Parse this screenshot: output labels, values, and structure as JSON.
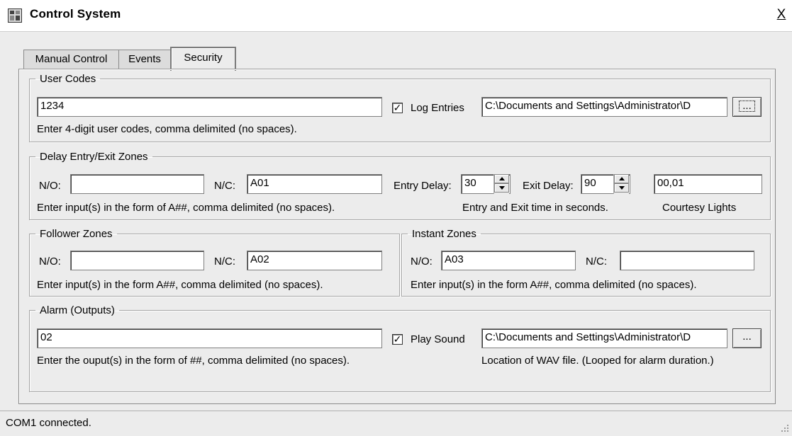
{
  "window": {
    "title": "Control System",
    "close_glyph": "X",
    "icon": "app-icon"
  },
  "tabs": [
    {
      "label": "Manual Control"
    },
    {
      "label": "Events"
    },
    {
      "label": "Security",
      "active": true
    }
  ],
  "user_codes": {
    "legend": "User Codes",
    "value": "1234",
    "log_entries_label": "Log Entries",
    "log_entries_checked": true,
    "log_path": "C:\\Documents and Settings\\Administrator\\D",
    "browse_label": "...",
    "hint": "Enter 4-digit user codes, comma delimited (no spaces)."
  },
  "delay_zones": {
    "legend": "Delay Entry/Exit Zones",
    "no_label": "N/O:",
    "no_value": "",
    "nc_label": "N/C:",
    "nc_value": "A01",
    "entry_delay_label": "Entry Delay:",
    "entry_delay_value": "30",
    "exit_delay_label": "Exit Delay:",
    "exit_delay_value": "90",
    "courtesy_value": "00,01",
    "hint": "Enter input(s) in the form of A##, comma delimited (no spaces).",
    "time_hint": "Entry and Exit time in seconds.",
    "courtesy_label": "Courtesy Lights"
  },
  "follower_zones": {
    "legend": "Follower Zones",
    "no_label": "N/O:",
    "no_value": "",
    "nc_label": "N/C:",
    "nc_value": "A02",
    "hint": "Enter input(s) in the form A##, comma delimited (no spaces)."
  },
  "instant_zones": {
    "legend": "Instant Zones",
    "no_label": "N/O:",
    "no_value": "A03",
    "nc_label": "N/C:",
    "nc_value": "",
    "hint": "Enter input(s) in the form A##, comma delimited (no spaces)."
  },
  "alarm": {
    "legend": "Alarm (Outputs)",
    "value": "02",
    "play_sound_label": "Play Sound",
    "play_sound_checked": true,
    "sound_path": "C:\\Documents and Settings\\Administrator\\D",
    "browse_label": "...",
    "hint": "Enter the ouput(s) in the form of ##, comma delimited (no spaces).",
    "file_hint": "Location of WAV file. (Looped for alarm duration.)"
  },
  "status": {
    "text": "COM1 connected."
  }
}
